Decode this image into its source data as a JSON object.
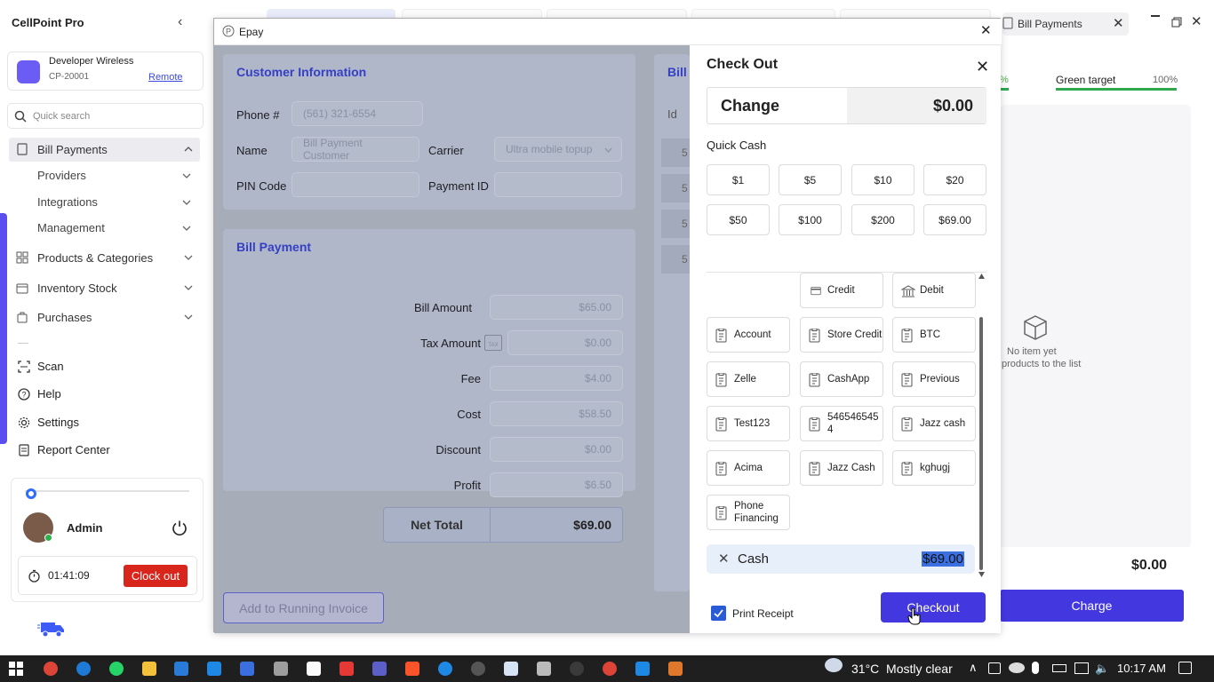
{
  "app": {
    "title": "CellPoint Pro"
  },
  "store": {
    "name": "Developer Wireless",
    "id": "CP-20001",
    "link": "Remote"
  },
  "search": {
    "placeholder": "Quick search"
  },
  "nav": {
    "bill_payments": "Bill Payments",
    "sub": [
      "Providers",
      "Integrations",
      "Management"
    ],
    "items": [
      "Products & Categories",
      "Inventory Stock",
      "Purchases"
    ],
    "bottom": [
      "Scan",
      "Help",
      "Settings",
      "Report Center"
    ]
  },
  "user": {
    "name": "Admin",
    "timer": "01:41:09",
    "clock_out": "Clock out"
  },
  "background": {
    "tab_label": "Bill Payments",
    "target_label": "Green target",
    "target_pct": "100%",
    "left_pct": "%",
    "empty_line1": "No item yet",
    "empty_line2": "products to the list",
    "total": "$0.00",
    "charge": "Charge"
  },
  "epay": {
    "title": "Epay",
    "customer": {
      "title": "Customer Information",
      "phone_label": "Phone #",
      "phone_placeholder": "(561) 321-6554",
      "name_label": "Name",
      "name_value": "Bill Payment Customer",
      "carrier_label": "Carrier",
      "carrier_value": "Ultra mobile topup",
      "pin_label": "PIN Code",
      "payment_id_label": "Payment ID"
    },
    "bill_side": {
      "title": "Bill I",
      "id_header": "Id",
      "rows": [
        "5",
        "5",
        "5",
        "5"
      ]
    },
    "bill_payment": {
      "title": "Bill Payment",
      "rows": [
        {
          "label": "Bill Amount",
          "value": "$65.00"
        },
        {
          "label": "Tax Amount",
          "value": "$0.00"
        },
        {
          "label": "Fee",
          "value": "$4.00"
        },
        {
          "label": "Cost",
          "value": "$58.50"
        },
        {
          "label": "Discount",
          "value": "$0.00"
        },
        {
          "label": "Profit",
          "value": "$6.50"
        }
      ],
      "tax_badge": "TAX",
      "net_label": "Net Total",
      "net_value": "$69.00"
    },
    "add_running": "Add to Running Invoice"
  },
  "checkout": {
    "title": "Check Out",
    "change_label": "Change",
    "change_value": "$0.00",
    "quick_cash_label": "Quick Cash",
    "quick_cash": [
      "$1",
      "$5",
      "$10",
      "$20",
      "$50",
      "$100",
      "$200",
      "$69.00"
    ],
    "top_methods": [
      "Credit",
      "Debit"
    ],
    "methods": [
      "Account",
      "Store Credit",
      "BTC",
      "Zelle",
      "CashApp",
      "Previous",
      "Test123",
      "546546545 4",
      "Jazz cash",
      "Acima",
      "Jazz Cash",
      "kghugj",
      "Phone Financing"
    ],
    "tender_label": "Cash",
    "tender_value": "$69.00",
    "print_receipt": "Print Receipt",
    "checkout_btn": "Checkout"
  },
  "taskbar": {
    "weather": "31°C  Mostly clear",
    "time": "10:17 AM"
  },
  "colors": {
    "accent": "#4338e0",
    "danger": "#d9261c",
    "link": "#3b4be0"
  }
}
